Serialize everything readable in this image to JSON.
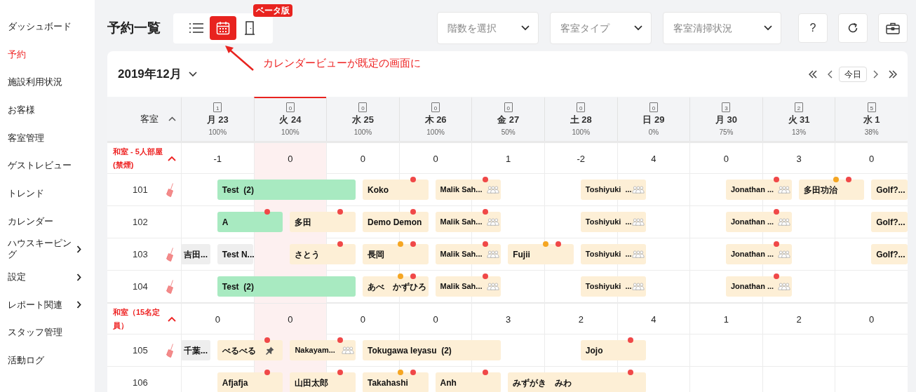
{
  "sidebar": {
    "items": [
      {
        "label": "ダッシュボード",
        "selected": false,
        "has_submenu": false
      },
      {
        "label": "予約",
        "selected": true,
        "has_submenu": false
      },
      {
        "label": "施設利用状況",
        "selected": false,
        "has_submenu": false
      },
      {
        "label": "お客様",
        "selected": false,
        "has_submenu": false
      },
      {
        "label": "客室管理",
        "selected": false,
        "has_submenu": false
      },
      {
        "label": "ゲストレビュー",
        "selected": false,
        "has_submenu": false
      },
      {
        "label": "トレンド",
        "selected": false,
        "has_submenu": false
      },
      {
        "label": "カレンダー",
        "selected": false,
        "has_submenu": false
      },
      {
        "label": "ハウスキーピング",
        "selected": false,
        "has_submenu": true
      },
      {
        "label": "設定",
        "selected": false,
        "has_submenu": true
      },
      {
        "label": "レポート関連",
        "selected": false,
        "has_submenu": true
      },
      {
        "label": "スタッフ管理",
        "selected": false,
        "has_submenu": false
      },
      {
        "label": "活動ログ",
        "selected": false,
        "has_submenu": false
      }
    ]
  },
  "header": {
    "title": "予約一覧",
    "view_modes": [
      {
        "kind": "list",
        "selected": false
      },
      {
        "kind": "calendar",
        "selected": true
      },
      {
        "kind": "door",
        "selected": false
      }
    ],
    "beta_badge": "ベータ版",
    "filters": [
      {
        "placeholder": "階数を選択"
      },
      {
        "placeholder": "客室タイプ"
      },
      {
        "placeholder": "客室清掃状況"
      }
    ],
    "buttons": [
      {
        "kind": "help",
        "label": "?"
      },
      {
        "kind": "refresh"
      },
      {
        "kind": "briefcase"
      }
    ]
  },
  "annotation": {
    "text": "カレンダービューが既定の画面に"
  },
  "calendar": {
    "month": "2019年12月",
    "today_button": "今日",
    "room_header": "客室",
    "days": [
      {
        "count": "1",
        "label": "月 23",
        "rate": "100%",
        "today": false
      },
      {
        "count": "0",
        "label": "火 24",
        "rate": "100%",
        "today": true
      },
      {
        "count": "0",
        "label": "水 25",
        "rate": "100%",
        "today": false
      },
      {
        "count": "0",
        "label": "木 26",
        "rate": "100%",
        "today": false
      },
      {
        "count": "0",
        "label": "金 27",
        "rate": "50%",
        "today": false
      },
      {
        "count": "0",
        "label": "土 28",
        "rate": "100%",
        "today": false
      },
      {
        "count": "0",
        "label": "日 29",
        "rate": "0%",
        "today": false
      },
      {
        "count": "3",
        "label": "月 30",
        "rate": "75%",
        "today": false
      },
      {
        "count": "2",
        "label": "火 31",
        "rate": "13%",
        "today": false
      },
      {
        "count": "5",
        "label": "水 1",
        "rate": "38%",
        "today": false
      }
    ],
    "sections": [
      {
        "name": "和室 - 5人部屋(禁煙)",
        "expanded": true,
        "counts": [
          "-1",
          "0",
          "0",
          "0",
          "1",
          "-2",
          "4",
          "0",
          "3",
          "0"
        ],
        "rooms": [
          {
            "number": "101",
            "needs_cleaning": true,
            "days": [
              {
                "kind": "check_in",
                "bookings": [
                  {
                    "guest": "Test  (2)",
                    "color": "#a8eac1",
                    "kind": "two_nights"
                  }
                ]
              },
              {
                "kind": "free"
              },
              {
                "kind": "check_in",
                "bookings": [
                  {
                    "guest": "Koko",
                    "color": "#fdefd6",
                    "kind": "one_night",
                    "dots": [
                      {
                        "color": "#f04848"
                      }
                    ]
                  }
                ]
              },
              {
                "kind": "check_in",
                "bookings": [
                  {
                    "guest": "Malik Sah...",
                    "color": "#fdefd6",
                    "kind": "one_night",
                    "group": true,
                    "dots": [
                      {
                        "color": "#f04848"
                      }
                    ]
                  }
                ]
              },
              {
                "kind": "free"
              },
              {
                "kind": "check_in",
                "bookings": [
                  {
                    "guest": "Toshiyuki  ...",
                    "color": "#fdefd6",
                    "kind": "one_night",
                    "group": true
                  }
                ]
              },
              {
                "kind": "free"
              },
              {
                "kind": "check_in",
                "bookings": [
                  {
                    "guest": "Jonathan ...",
                    "color": "#fdefd6",
                    "kind": "one_night",
                    "group": true,
                    "dots": [
                      {
                        "color": "#f04848"
                      }
                    ]
                  }
                ]
              },
              {
                "kind": "check_in",
                "bookings": [
                  {
                    "guest": "多田功治",
                    "color": "#fdefd6",
                    "kind": "one_night",
                    "dots": [
                      {
                        "color": "#f5a623"
                      },
                      {
                        "color": "#f04848"
                      }
                    ]
                  }
                ]
              },
              {
                "kind": "check_in",
                "bookings": [
                  {
                    "guest": "Golf?...",
                    "color": "#fdefd6",
                    "kind": "one_night"
                  }
                ]
              }
            ]
          },
          {
            "number": "102",
            "needs_cleaning": false,
            "days": [
              {
                "kind": "check_in",
                "bookings": [
                  {
                    "guest": "A",
                    "color": "#a8eac1",
                    "kind": "one_night",
                    "dots": [
                      {
                        "color": "#f04848"
                      }
                    ]
                  }
                ]
              },
              {
                "kind": "check_in",
                "bookings": [
                  {
                    "guest": "多田",
                    "color": "#fdefd6",
                    "kind": "one_night",
                    "dots": [
                      {
                        "color": "#f04848"
                      }
                    ]
                  }
                ]
              },
              {
                "kind": "check_in",
                "bookings": [
                  {
                    "guest": "Demo Demon",
                    "color": "#fdefd6",
                    "kind": "one_night",
                    "dots": [
                      {
                        "color": "#f04848"
                      }
                    ]
                  }
                ]
              },
              {
                "kind": "check_in",
                "bookings": [
                  {
                    "guest": "Malik Sah...",
                    "color": "#fdefd6",
                    "kind": "one_night",
                    "group": true,
                    "dots": [
                      {
                        "color": "#f04848"
                      }
                    ]
                  }
                ]
              },
              {
                "kind": "free"
              },
              {
                "kind": "check_in",
                "bookings": [
                  {
                    "guest": "Toshiyuki  ...",
                    "color": "#fdefd6",
                    "kind": "one_night",
                    "group": true
                  }
                ]
              },
              {
                "kind": "free"
              },
              {
                "kind": "check_in",
                "bookings": [
                  {
                    "guest": "Jonathan ...",
                    "color": "#fdefd6",
                    "kind": "one_night",
                    "group": true,
                    "dots": [
                      {
                        "color": "#f04848"
                      }
                    ]
                  }
                ]
              },
              {
                "kind": "free"
              },
              {
                "kind": "check_in",
                "bookings": [
                  {
                    "guest": "Golf?...",
                    "color": "#fdefd6",
                    "kind": "one_night"
                  }
                ]
              }
            ]
          },
          {
            "number": "103",
            "needs_cleaning": true,
            "days": [
              {
                "kind": "check_in",
                "bookings": [
                  {
                    "guest": "吉田...",
                    "color": "#eeeeee",
                    "kind": "carry_over"
                  },
                  {
                    "guest": "Test N...",
                    "color": "#eeeeee",
                    "kind": "day_use"
                  }
                ]
              },
              {
                "kind": "check_in",
                "bookings": [
                  {
                    "guest": "さとう",
                    "color": "#fdefd6",
                    "kind": "one_night",
                    "dots": [
                      {
                        "color": "#f04848"
                      }
                    ]
                  }
                ]
              },
              {
                "kind": "check_in",
                "bookings": [
                  {
                    "guest": "長岡",
                    "color": "#fdefd6",
                    "kind": "one_night",
                    "dots": [
                      {
                        "color": "#f5a623"
                      },
                      {
                        "color": "#f04848"
                      }
                    ]
                  }
                ]
              },
              {
                "kind": "check_in",
                "bookings": [
                  {
                    "guest": "Malik Sah...",
                    "color": "#fdefd6",
                    "kind": "one_night",
                    "group": true,
                    "dots": [
                      {
                        "color": "#f04848"
                      }
                    ]
                  }
                ]
              },
              {
                "kind": "check_in",
                "bookings": [
                  {
                    "guest": "Fujii",
                    "color": "#fdefd6",
                    "kind": "one_night",
                    "dots": [
                      {
                        "color": "#f5a623"
                      },
                      {
                        "color": "#f04848"
                      }
                    ]
                  }
                ]
              },
              {
                "kind": "check_in",
                "bookings": [
                  {
                    "guest": "Toshiyuki  ...",
                    "color": "#fdefd6",
                    "kind": "one_night",
                    "group": true
                  }
                ]
              },
              {
                "kind": "free"
              },
              {
                "kind": "check_in",
                "bookings": [
                  {
                    "guest": "Jonathan ...",
                    "color": "#fdefd6",
                    "kind": "one_night",
                    "group": true,
                    "dots": [
                      {
                        "color": "#f04848"
                      }
                    ]
                  }
                ]
              },
              {
                "kind": "free"
              },
              {
                "kind": "check_in",
                "bookings": [
                  {
                    "guest": "Golf?...",
                    "color": "#fdefd6",
                    "kind": "one_night"
                  }
                ]
              }
            ]
          },
          {
            "number": "104",
            "needs_cleaning": true,
            "days": [
              {
                "kind": "check_in",
                "bookings": [
                  {
                    "guest": "Test  (2)",
                    "color": "#a8eac1",
                    "kind": "two_nights"
                  }
                ]
              },
              {
                "kind": "free"
              },
              {
                "kind": "check_in",
                "bookings": [
                  {
                    "guest": "あべ　かずひろ",
                    "color": "#fdefd6",
                    "kind": "one_night",
                    "dots": [
                      {
                        "color": "#f5a623"
                      },
                      {
                        "color": "#f04848"
                      }
                    ]
                  }
                ]
              },
              {
                "kind": "check_in",
                "bookings": [
                  {
                    "guest": "Malik Sah...",
                    "color": "#fdefd6",
                    "kind": "one_night",
                    "group": true,
                    "dots": [
                      {
                        "color": "#f04848"
                      }
                    ]
                  }
                ]
              },
              {
                "kind": "free"
              },
              {
                "kind": "check_in",
                "bookings": [
                  {
                    "guest": "Toshiyuki  ...",
                    "color": "#fdefd6",
                    "kind": "one_night",
                    "group": true
                  }
                ]
              },
              {
                "kind": "free"
              },
              {
                "kind": "check_in",
                "bookings": [
                  {
                    "guest": "Jonathan ...",
                    "color": "#fdefd6",
                    "kind": "one_night",
                    "group": true,
                    "dots": [
                      {
                        "color": "#f04848"
                      }
                    ]
                  }
                ]
              },
              {
                "kind": "free"
              },
              {
                "kind": "free"
              }
            ]
          }
        ]
      },
      {
        "name": "和室（15名定員）",
        "expanded": true,
        "counts": [
          "0",
          "0",
          "0",
          "0",
          "3",
          "2",
          "4",
          "1",
          "2",
          "0"
        ],
        "rooms": [
          {
            "number": "105",
            "needs_cleaning": true,
            "days": [
              {
                "kind": "check_in",
                "bookings": [
                  {
                    "guest": "千葉...",
                    "color": "#eeeeee",
                    "kind": "carry_over"
                  },
                  {
                    "guest": "べるべる",
                    "color": "#fdefd6",
                    "kind": "one_night",
                    "pinned": true,
                    "dots": [
                      {
                        "color": "#f04848"
                      }
                    ]
                  }
                ]
              },
              {
                "kind": "check_in",
                "bookings": [
                  {
                    "guest": "Nakayam...",
                    "color": "#fdefd6",
                    "kind": "one_night",
                    "group": true,
                    "dots": [
                      {
                        "color": "#f04848"
                      }
                    ]
                  }
                ]
              },
              {
                "kind": "check_in",
                "bookings": [
                  {
                    "guest": "Tokugawa Ieyasu  (2)",
                    "color": "#fdefd6",
                    "kind": "two_nights"
                  }
                ]
              },
              {
                "kind": "free"
              },
              {
                "kind": "free"
              },
              {
                "kind": "check_in",
                "bookings": [
                  {
                    "guest": "Jojo",
                    "color": "#fdefd6",
                    "kind": "one_night",
                    "dots": [
                      {
                        "color": "#f04848"
                      }
                    ]
                  }
                ]
              },
              {
                "kind": "free"
              },
              {
                "kind": "free"
              },
              {
                "kind": "free"
              },
              {
                "kind": "free"
              }
            ]
          },
          {
            "number": "106",
            "needs_cleaning": false,
            "days": [
              {
                "kind": "check_in",
                "bookings": [
                  {
                    "guest": "Afjafja",
                    "color": "#fdefd6",
                    "kind": "one_night",
                    "dots": [
                      {
                        "color": "#f04848"
                      }
                    ]
                  }
                ]
              },
              {
                "kind": "check_in",
                "bookings": [
                  {
                    "guest": "山田太郎",
                    "color": "#fdefd6",
                    "kind": "one_night",
                    "dots": [
                      {
                        "color": "#f04848"
                      }
                    ]
                  }
                ]
              },
              {
                "kind": "check_in",
                "bookings": [
                  {
                    "guest": "Takahashi",
                    "color": "#fdefd6",
                    "kind": "one_night",
                    "dots": [
                      {
                        "color": "#f5a623"
                      },
                      {
                        "color": "#f04848"
                      }
                    ]
                  }
                ]
              },
              {
                "kind": "check_in",
                "bookings": [
                  {
                    "guest": "Anh",
                    "color": "#fdefd6",
                    "kind": "one_night",
                    "dots": [
                      {
                        "color": "#f04848"
                      }
                    ]
                  }
                ]
              },
              {
                "kind": "check_in",
                "bookings": [
                  {
                    "guest": "みずがき　みわ",
                    "color": "#fdefd6",
                    "kind": "two_nights",
                    "dots": [
                      {
                        "color": "#f04848"
                      }
                    ]
                  }
                ]
              },
              {
                "kind": "free"
              },
              {
                "kind": "free"
              },
              {
                "kind": "free"
              },
              {
                "kind": "free"
              },
              {
                "kind": "free"
              }
            ]
          }
        ]
      }
    ]
  }
}
